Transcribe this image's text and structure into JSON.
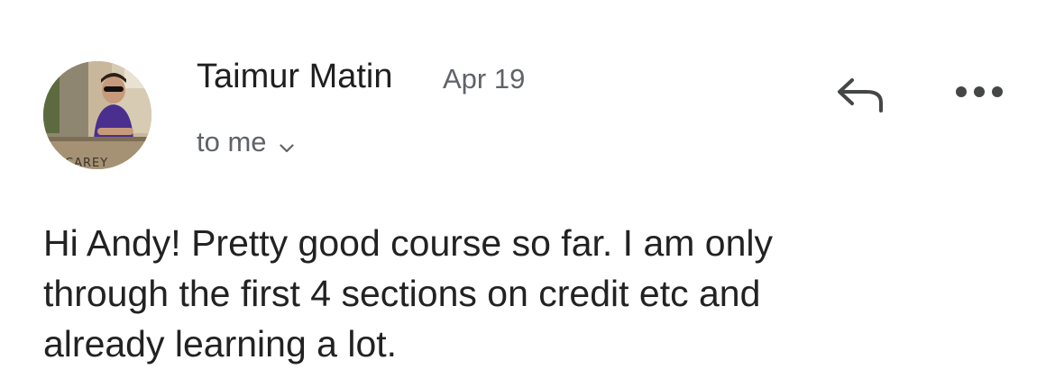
{
  "message": {
    "sender_name": "Taimur Matin",
    "date": "Apr 19",
    "recipient": "to me",
    "body": "Hi Andy! Pretty good course so far. I am only\nthrough the first 4 sections on credit etc and\nalready learning a lot."
  },
  "avatar": {
    "caption": "CAREY"
  },
  "icons": {
    "expand": "chevron-down-icon",
    "reply": "reply-arrow-icon",
    "more": "more-horizontal-icon"
  },
  "colors": {
    "text_primary": "#1f1f1f",
    "text_secondary": "#5f6368",
    "icon": "#444746"
  }
}
